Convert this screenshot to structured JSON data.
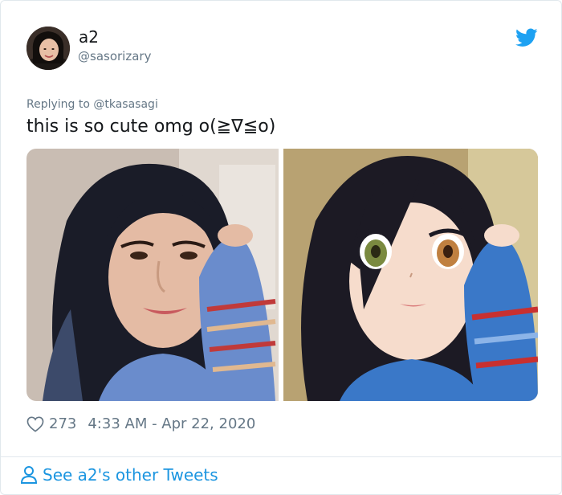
{
  "author": {
    "display_name": "a2",
    "handle": "@sasorizary"
  },
  "reply_line": "Replying to @tkasasagi",
  "tweet_text": "this is so cute omg o(≧∇≦o)",
  "media": [
    {
      "description": "photo-woman"
    },
    {
      "description": "anime-illustration-woman"
    }
  ],
  "likes": "273",
  "timestamp": "4:33 AM - Apr 22, 2020",
  "footer_link": "See a2's other Tweets",
  "colors": {
    "twitter_blue": "#1da1f2",
    "link_blue": "#1b95e0",
    "secondary_text": "#657786",
    "primary_text": "#14171a",
    "border": "#e1e8ed"
  },
  "icons": [
    "twitter-bird-icon",
    "heart-icon",
    "person-icon"
  ]
}
